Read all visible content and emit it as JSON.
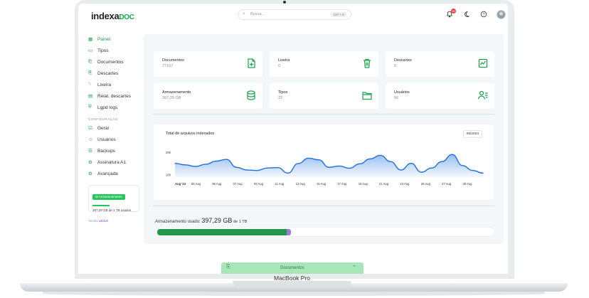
{
  "header": {
    "logo_main": "indexa",
    "logo_accent": "DOC",
    "search_placeholder": "Busca...",
    "search_shortcut": "Ctrl + K",
    "notification_count": "10"
  },
  "sidebar": {
    "items": [
      {
        "label": "Painel",
        "icon": "dashboard-icon",
        "active": true
      },
      {
        "label": "Tipos",
        "icon": "folder-icon"
      },
      {
        "label": "Documentos",
        "icon": "document-icon"
      },
      {
        "label": "Descartes",
        "icon": "discard-icon"
      },
      {
        "label": "Lixeira",
        "icon": "trash-icon"
      },
      {
        "label": "Relat. descartes",
        "icon": "report-icon"
      },
      {
        "label": "Lgpd logs",
        "icon": "shield-icon"
      }
    ],
    "section_title": "CONFIGURAÇÃO",
    "config_items": [
      {
        "label": "Geral",
        "icon": "settings-icon"
      },
      {
        "label": "Usuários",
        "icon": "users-icon"
      },
      {
        "label": "Backups",
        "icon": "backup-icon"
      },
      {
        "label": "Assinatura A1",
        "icon": "signature-icon"
      },
      {
        "label": "Avançada",
        "icon": "gear-icon"
      }
    ],
    "storage_widget": {
      "label": "Armazenamento",
      "usage_text": "397,29 GB de 1 TB usados",
      "fill_fraction": 0.4
    },
    "version_label": "Versão",
    "version_value": "v2.0.0"
  },
  "cards": [
    {
      "title": "Documentos",
      "value": "77107",
      "icon": "add-document-icon"
    },
    {
      "title": "Lixeira",
      "value": "0",
      "icon": "trash-icon"
    },
    {
      "title": "Descartes",
      "value": "0",
      "icon": "chart-file-icon"
    },
    {
      "title": "Armazenamento",
      "value": "397,29 GB",
      "icon": "database-icon"
    },
    {
      "title": "Tipos",
      "value": "33",
      "icon": "folder-icon"
    },
    {
      "title": "Usuários",
      "value": "56",
      "icon": "users-list-icon"
    }
  ],
  "chart_data": {
    "type": "area",
    "title": "Total de arquivos indexados",
    "period": "08/2024",
    "y_ticks": [
      "200",
      "100"
    ],
    "ylim": [
      90,
      215
    ],
    "x_ticks": [
      "Aug '24",
      "03 Aug",
      "05 Aug",
      "07 Aug",
      "09 Aug",
      "11 Aug",
      "13 Aug",
      "15 Aug",
      "17 Aug",
      "19 Aug",
      "21 Aug",
      "23 Aug",
      "25 Aug",
      "27 Aug",
      "29 Aug"
    ],
    "x": [
      1,
      2,
      3,
      4,
      5,
      6,
      7,
      8,
      9,
      10,
      11,
      12,
      13,
      14,
      15,
      16,
      17,
      18,
      19,
      20,
      21,
      22,
      23,
      24,
      25,
      26,
      27,
      28,
      29,
      30,
      31
    ],
    "values": [
      152,
      145,
      138,
      148,
      162,
      170,
      134,
      122,
      120,
      131,
      133,
      108,
      151,
      175,
      168,
      134,
      140,
      130,
      150,
      172,
      188,
      160,
      122,
      152,
      112,
      131,
      160,
      192,
      142,
      120,
      108
    ],
    "color": "#1e6fe0"
  },
  "storage": {
    "label_prefix": "Armazenamento usado:",
    "used": "397,29 GB",
    "label_suffix": "de 1 TB",
    "used_fraction": 0.385,
    "trash_fraction": 0.012,
    "used_color": "#22994a",
    "trash_color": "#9b7be0"
  },
  "bottom_bar": {
    "label": "Documentos"
  },
  "device_label": "MacBook Pro",
  "colors": {
    "brand": "#16a34a",
    "background": "#f4f7fa"
  }
}
